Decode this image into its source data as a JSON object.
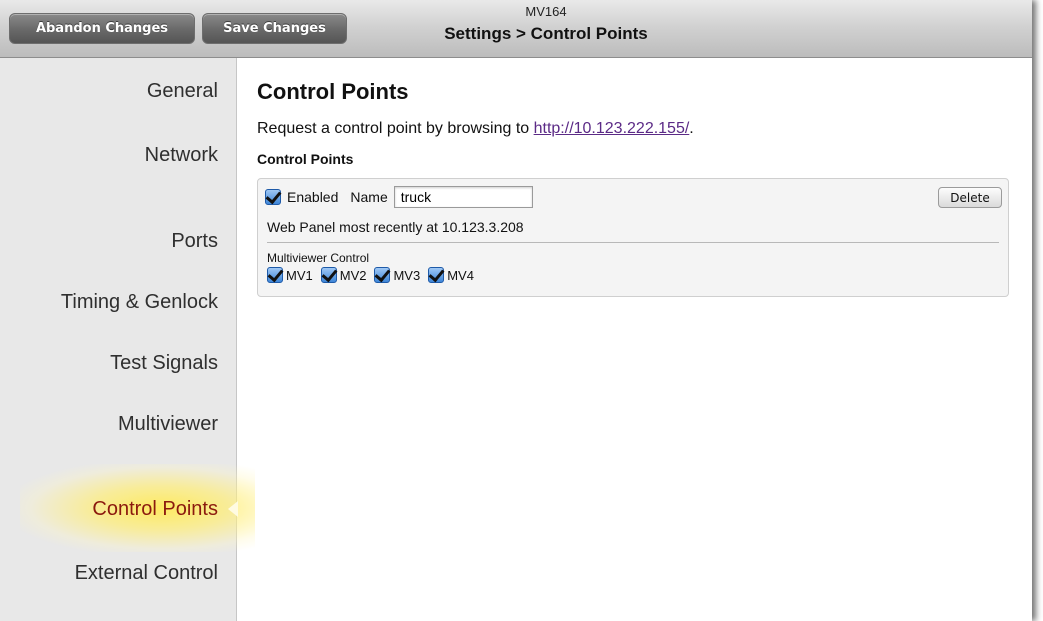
{
  "toolbar": {
    "abandon_label": "Abandon Changes",
    "save_label": "Save Changes",
    "device_name": "MV164",
    "breadcrumb": "Settings > Control Points"
  },
  "sidebar": {
    "items": [
      {
        "label": "General",
        "active": false
      },
      {
        "label": "Network",
        "active": false
      },
      {
        "label": "Ports",
        "active": false
      },
      {
        "label": "Timing & Genlock",
        "active": false
      },
      {
        "label": "Test Signals",
        "active": false
      },
      {
        "label": "Multiviewer",
        "active": false
      },
      {
        "label": "Control Points",
        "active": true
      },
      {
        "label": "External Control",
        "active": false
      }
    ]
  },
  "main": {
    "title": "Control Points",
    "request_prefix": "Request a control point by browsing to ",
    "request_link": "http://10.123.222.155/",
    "request_suffix": ".",
    "section_heading": "Control Points",
    "control_point": {
      "enabled_label": "Enabled",
      "enabled": true,
      "name_label": "Name",
      "name_value": "truck",
      "delete_label": "Delete",
      "web_panel_text": "Web Panel most recently at 10.123.3.208",
      "multiviewer_label": "Multiviewer Control",
      "multiviewers": [
        {
          "label": "MV1",
          "checked": true
        },
        {
          "label": "MV2",
          "checked": true
        },
        {
          "label": "MV3",
          "checked": true
        },
        {
          "label": "MV4",
          "checked": true
        }
      ]
    }
  },
  "colors": {
    "active_sidebar_text": "#8b1a0e",
    "link": "#5b2a86",
    "highlight_glow": "#ffea5a"
  }
}
